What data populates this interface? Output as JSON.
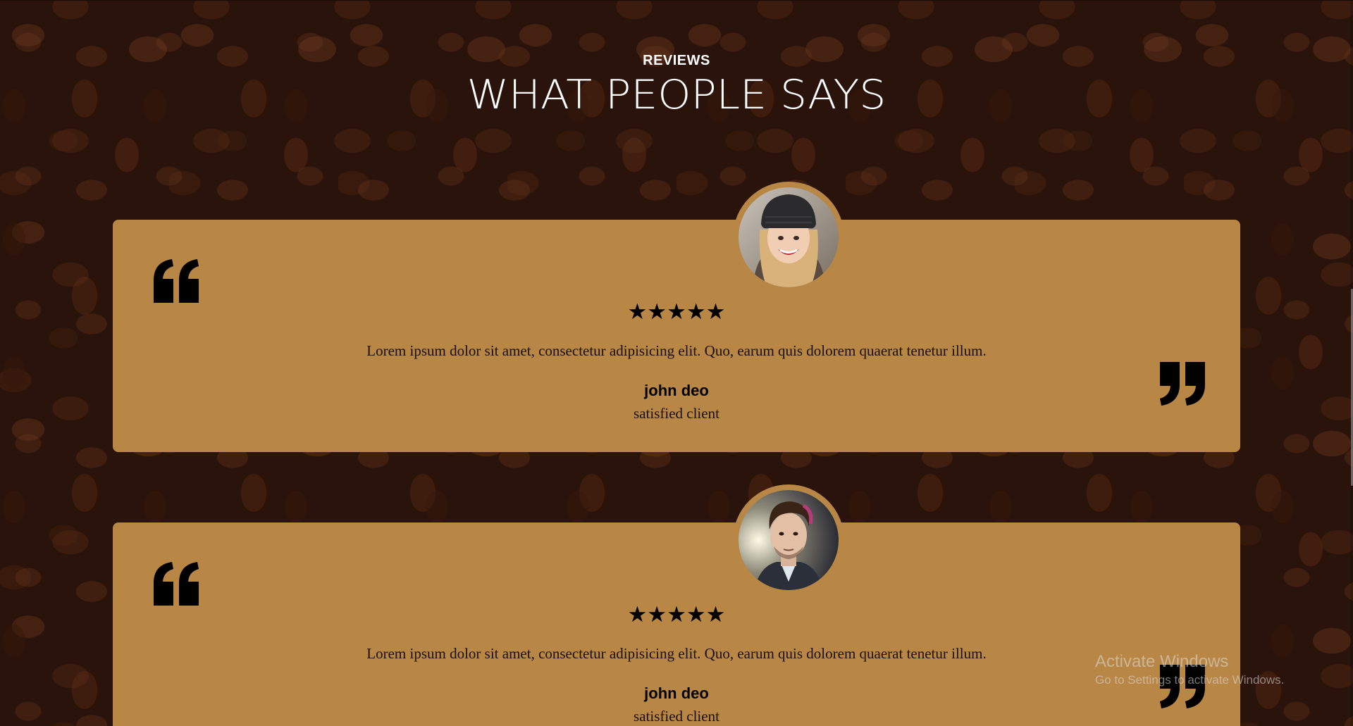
{
  "section": {
    "kicker": "REVIEWS",
    "title": "WHAT PEOPLE SAYS"
  },
  "reviews": [
    {
      "avatar": "woman-in-beanie-photo",
      "stars": "★★★★★",
      "rating": 5,
      "text": "Lorem ipsum dolor sit amet, consectetur adipisicing elit. Quo, earum quis dolorem quaerat tenetur illum.",
      "name": "john deo",
      "role": "satisfied client"
    },
    {
      "avatar": "man-portrait-photo",
      "stars": "★★★★★",
      "rating": 5,
      "text": "Lorem ipsum dolor sit amet, consectetur adipisicing elit. Quo, earum quis dolorem quaerat tenetur illum.",
      "name": "john deo",
      "role": "satisfied client"
    }
  ],
  "icons": {
    "quote_open": "quote-open-icon",
    "quote_close": "quote-close-icon",
    "star": "star-icon"
  },
  "colors": {
    "card": "#b88645",
    "background": "#2e160c",
    "text": "#000000"
  },
  "watermark": {
    "title": "Activate Windows",
    "subtitle": "Go to Settings to activate Windows."
  }
}
